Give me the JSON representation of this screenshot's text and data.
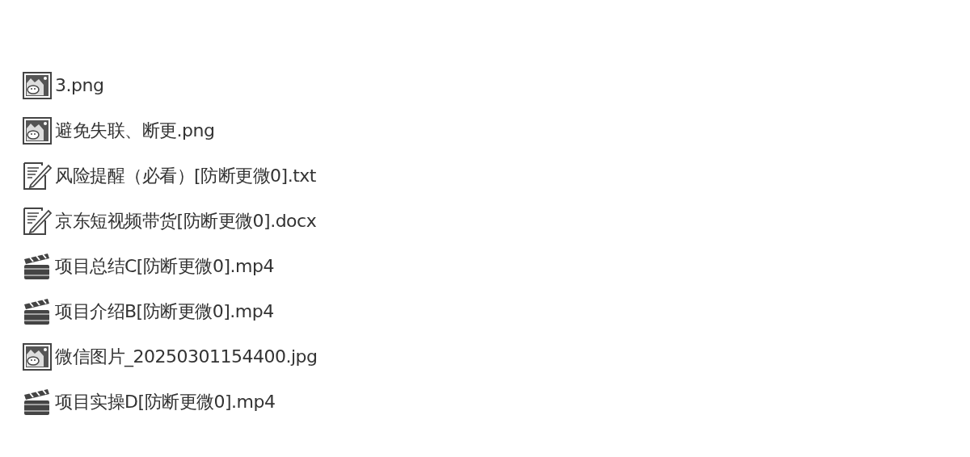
{
  "files": [
    {
      "kind": "image",
      "name": "3.png"
    },
    {
      "kind": "image",
      "name": "避免失联、断更.png"
    },
    {
      "kind": "text",
      "name": "风险提醒（必看）[防断更微0].txt"
    },
    {
      "kind": "text",
      "name": "京东短视频带货[防断更微0].docx"
    },
    {
      "kind": "video",
      "name": "项目总结C[防断更微0].mp4"
    },
    {
      "kind": "video",
      "name": "项目介绍B[防断更微0].mp4"
    },
    {
      "kind": "image",
      "name": "微信图片_20250301154400.jpg"
    },
    {
      "kind": "video",
      "name": "项目实操D[防断更微0].mp4"
    }
  ]
}
